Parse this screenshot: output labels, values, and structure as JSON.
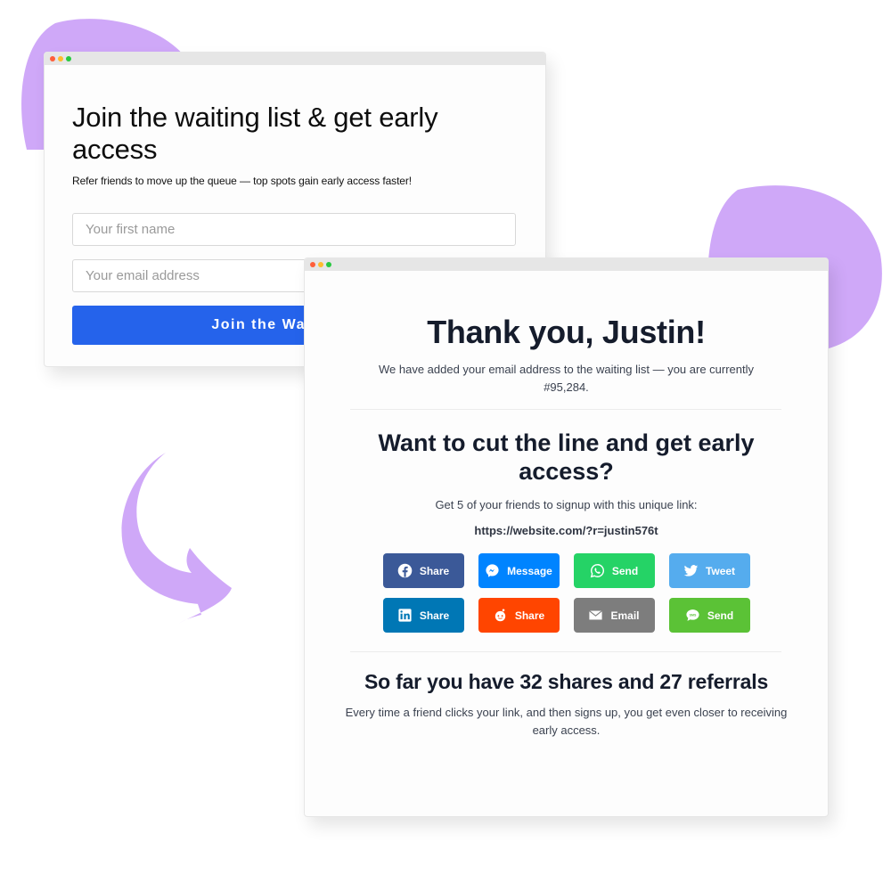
{
  "decor": {
    "blob_color": "#cfa8f8",
    "arrow_color": "#cfa8f8"
  },
  "signup_window": {
    "traffic_lights": [
      "#fe5f3a",
      "#febc2e",
      "#28c840"
    ],
    "title": "Join the waiting list & get early access",
    "subtitle": "Refer friends to move up the queue — top spots gain early access faster!",
    "first_name": {
      "value": "",
      "placeholder": "Your first name"
    },
    "email": {
      "value": "",
      "placeholder": "Your email address"
    },
    "submit_label": "Join the Waiting List",
    "accent": "#2563eb"
  },
  "thankyou_window": {
    "traffic_lights": [
      "#fe5f3a",
      "#febc2e",
      "#28c840"
    ],
    "title": "Thank you, Justin!",
    "added_message": "We have added your email address to the waiting list — you are currently #95,284.",
    "cut_heading": "Want to cut the line and get early access?",
    "referral_instruction": "Get 5 of your friends to signup with this unique link:",
    "referral_link": "https://website.com/?r=justin576t",
    "share_buttons": [
      {
        "network": "facebook",
        "icon": "facebook-icon",
        "label": "Share",
        "color": "#3b5998"
      },
      {
        "network": "messenger",
        "icon": "messenger-icon",
        "label": "Message",
        "color": "#0084ff"
      },
      {
        "network": "whatsapp",
        "icon": "whatsapp-icon",
        "label": "Send",
        "color": "#25d366"
      },
      {
        "network": "twitter",
        "icon": "twitter-icon",
        "label": "Tweet",
        "color": "#55acee"
      },
      {
        "network": "linkedin",
        "icon": "linkedin-icon",
        "label": "Share",
        "color": "#0077b5"
      },
      {
        "network": "reddit",
        "icon": "reddit-icon",
        "label": "Share",
        "color": "#ff4500"
      },
      {
        "network": "email",
        "icon": "email-icon",
        "label": "Email",
        "color": "#7d7d7d"
      },
      {
        "network": "sms",
        "icon": "sms-icon",
        "label": "Send",
        "color": "#5bc236"
      }
    ],
    "stats_heading": "So far you have 32 shares and 27 referrals",
    "shares": 32,
    "referrals": 27,
    "stats_description": "Every time a friend clicks your link, and then signs up, you get even closer to receiving early access."
  }
}
